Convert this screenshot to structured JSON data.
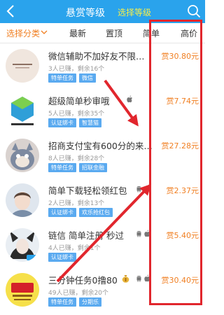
{
  "header": {
    "title": "悬赏等级",
    "subtitle": "选择等级"
  },
  "filters": {
    "category": "选择分类",
    "newest": "最新",
    "pinned": "置顶",
    "simple": "简单",
    "high_price": "高价"
  },
  "tasks": [
    {
      "title": "微信辅助不加好友不限…",
      "stats": "3人已赚，剩余16个",
      "tags": [
        "特单任务",
        "微信"
      ],
      "reward": "赏30.80元",
      "platforms": []
    },
    {
      "title": "超级简单秒审哦",
      "stats": "5人已赚，剩余35个",
      "tags": [
        "认证绑卡",
        "智慧猫"
      ],
      "reward": "赏7.74元",
      "platforms": [
        "apple"
      ]
    },
    {
      "title": "招商支付宝有600分的来…",
      "stats": "8人已赚，剩余28个",
      "tags": [
        "特单任务",
        "招联金融"
      ],
      "reward": "赏27.28元",
      "platforms": []
    },
    {
      "title": "简单下载轻松领红包",
      "stats": "2人已赚，剩余13个",
      "tags": [
        "认证绑卡",
        "欢乐抢红包"
      ],
      "reward": "赏2.37元",
      "platforms": [
        "android",
        "apple"
      ]
    },
    {
      "title": "链信 简单注册 秒过",
      "stats": "4人已赚，剩余1个",
      "tags": [
        "认证绑卡"
      ],
      "reward": "赏5.40元",
      "platforms": [
        "android",
        "apple"
      ]
    },
    {
      "title": "三分钟任务0撸80",
      "stats": "49人已赚，剩余20个",
      "tags": [
        "特单任务",
        "分期乐"
      ],
      "reward": "赏30.40元",
      "platforms": [
        "money-bag",
        "android",
        "apple"
      ]
    }
  ],
  "colors": {
    "header_bg": "#2aa3ec",
    "subtitle": "#f7ef4a",
    "accent_orange": "#f07f22",
    "tag_bg": "#5aaaf0",
    "annotation_red": "#e1262d"
  }
}
